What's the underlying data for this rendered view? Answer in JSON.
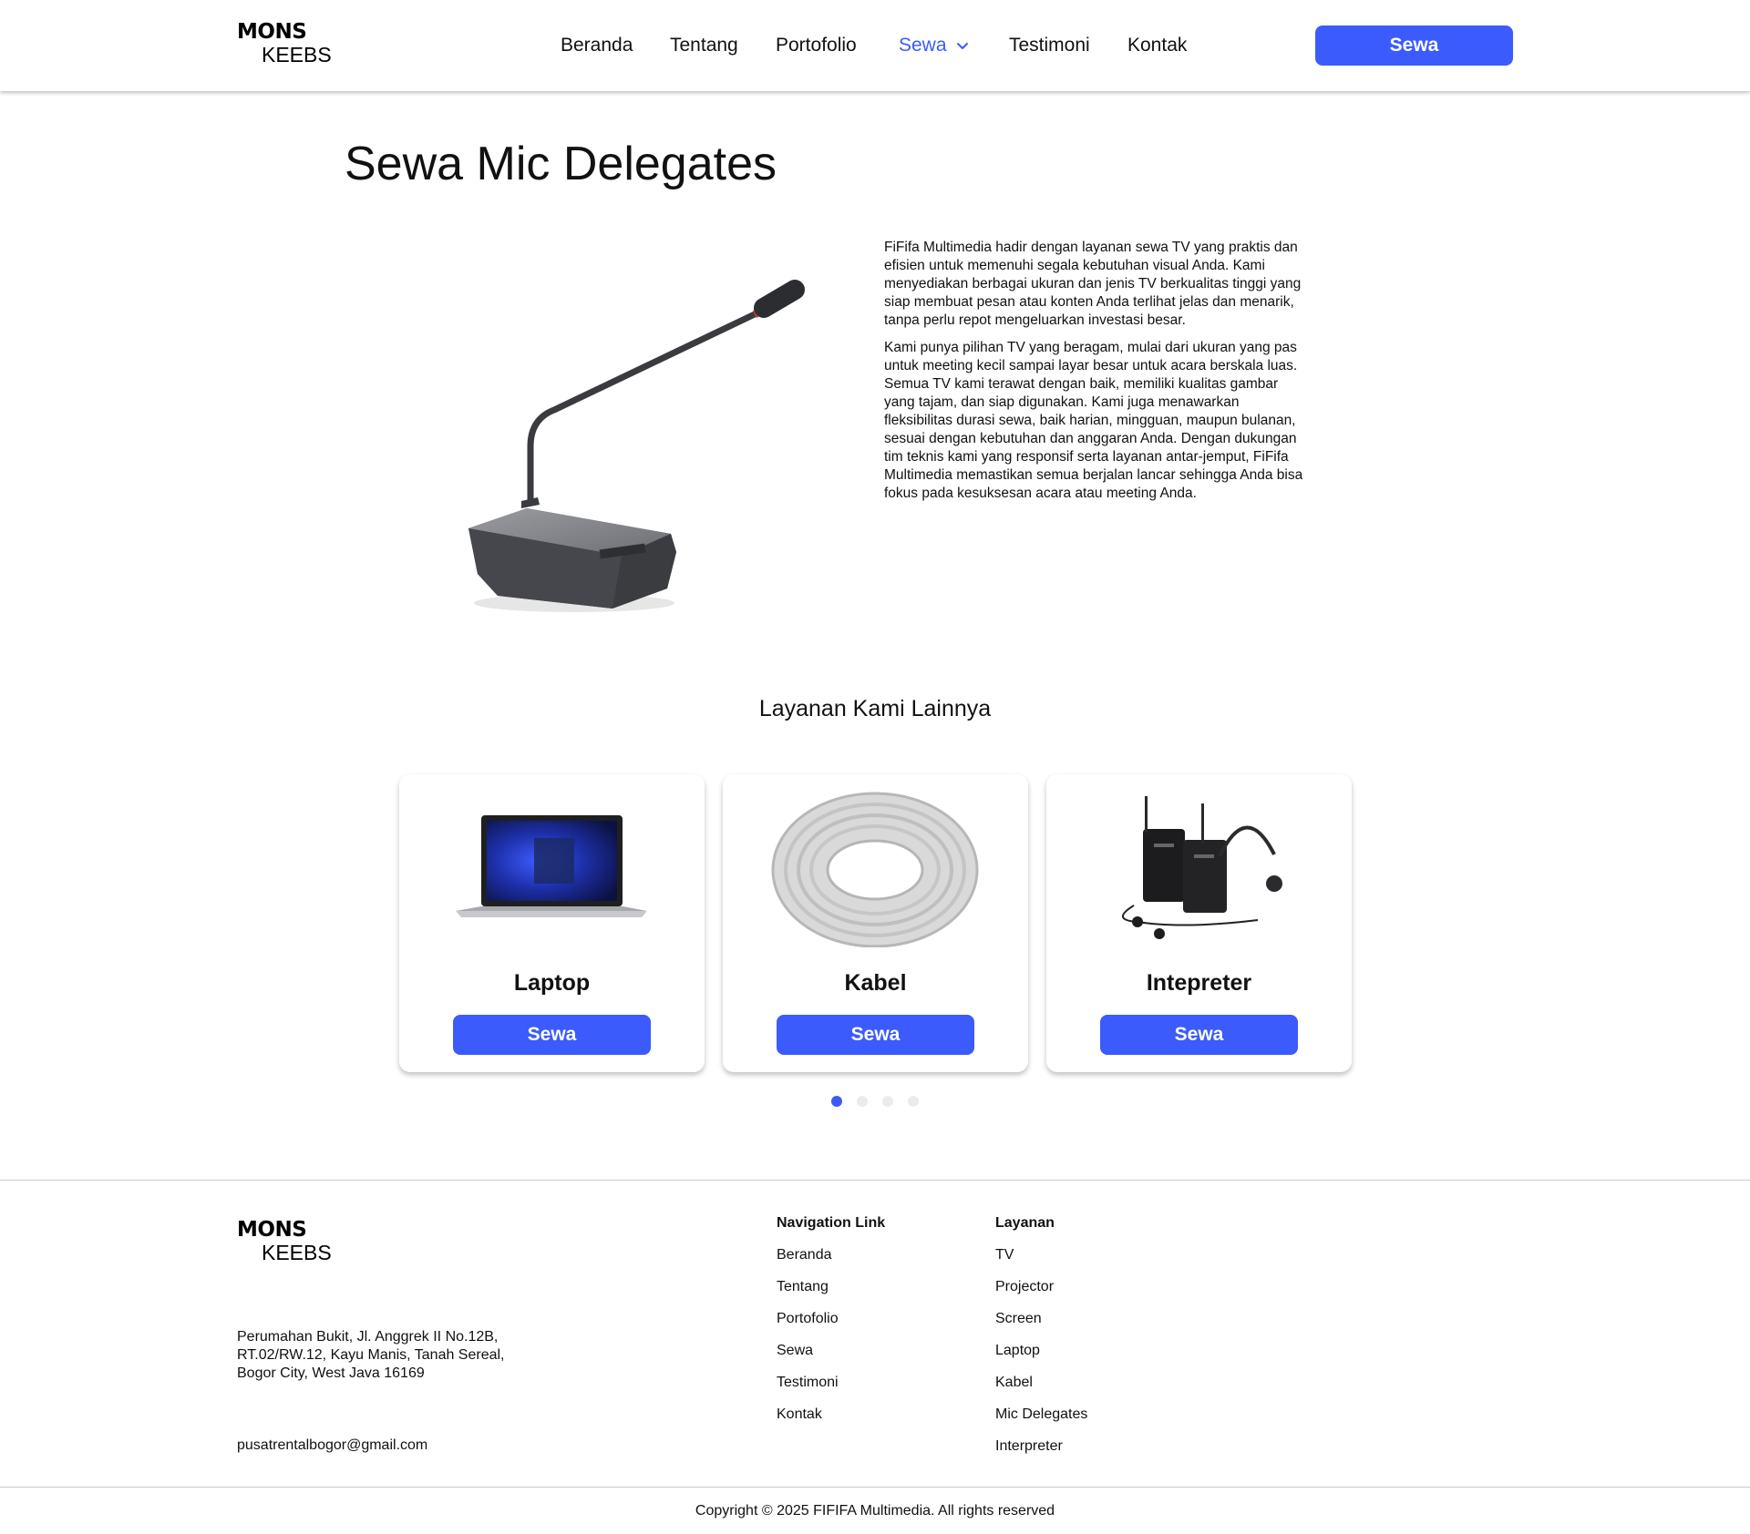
{
  "brand": {
    "line1": "MONS",
    "line2": "KEEBS"
  },
  "nav": {
    "items": [
      "Beranda",
      "Tentang",
      "Portofolio",
      "Sewa",
      "Testimoni",
      "Kontak"
    ],
    "active": "Sewa",
    "cta_label": "Sewa"
  },
  "page": {
    "title": "Sewa Mic Delegates",
    "paragraphs": [
      "FiFifa Multimedia hadir dengan layanan sewa TV yang praktis dan efisien untuk memenuhi segala kebutuhan visual Anda. Kami menyediakan berbagai ukuran dan jenis TV berkualitas tinggi yang siap membuat pesan atau konten Anda terlihat jelas dan menarik, tanpa perlu repot mengeluarkan investasi besar.",
      "Kami punya pilihan TV yang beragam, mulai dari ukuran yang pas untuk meeting kecil sampai layar besar untuk acara berskala luas. Semua TV kami terawat dengan baik, memiliki kualitas gambar yang tajam, dan siap digunakan. Kami juga menawarkan fleksibilitas durasi sewa, baik harian, mingguan, maupun bulanan, sesuai dengan kebutuhan dan anggaran Anda. Dengan dukungan tim teknis kami yang responsif serta layanan antar-jemput, FiFifa Multimedia memastikan semua berjalan lancar sehingga Anda bisa fokus pada kesuksesan acara atau meeting Anda."
    ]
  },
  "other_services": {
    "title": "Layanan Kami Lainnya",
    "cards": [
      {
        "name": "Laptop",
        "button": "Sewa",
        "icon": "laptop-image"
      },
      {
        "name": "Kabel",
        "button": "Sewa",
        "icon": "cable-coil-image"
      },
      {
        "name": "Intepreter",
        "button": "Sewa",
        "icon": "interpreter-set-image"
      }
    ],
    "carousel": {
      "pages": 4,
      "active_index": 0
    }
  },
  "footer": {
    "address": "Perumahan Bukit, Jl. Anggrek II No.12B, RT.02/RW.12, Kayu Manis, Tanah Sereal, Bogor City, West Java 16169",
    "email": "pusatrentalbogor@gmail.com",
    "nav_title": "Navigation Link",
    "nav_links": [
      "Beranda",
      "Tentang",
      "Portofolio",
      "Sewa",
      "Testimoni",
      "Kontak"
    ],
    "services_title": "Layanan",
    "services_links": [
      "TV",
      "Projector",
      "Screen",
      "Laptop",
      "Kabel",
      "Mic Delegates",
      "Interpreter"
    ],
    "copyright": "Copyright © 2025 FIFIFA Multimedia. All rights reserved"
  },
  "colors": {
    "accent": "#3b5bfd",
    "text": "#111111",
    "divider": "#c9c9c9",
    "dot_inactive": "#ebebeb"
  }
}
